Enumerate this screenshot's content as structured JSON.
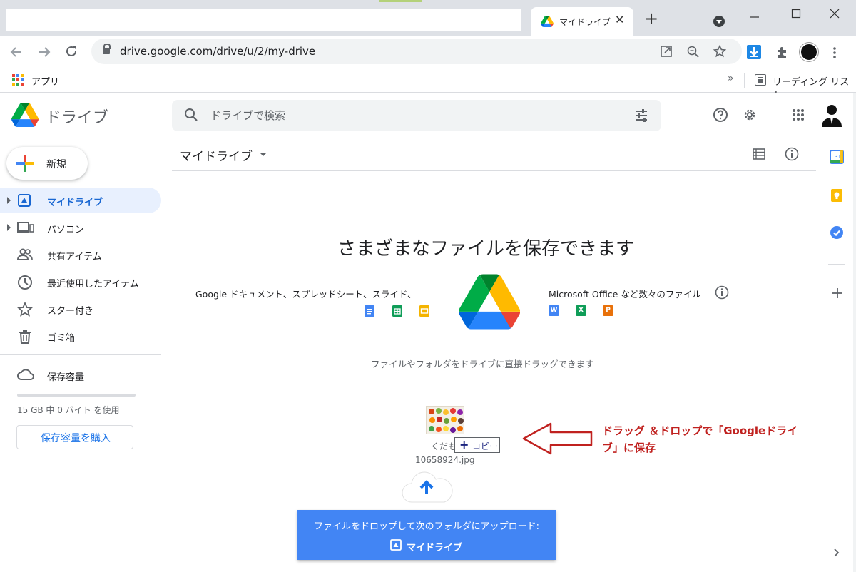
{
  "browser": {
    "tab_title": "マイドライブ",
    "tab_close": "✕",
    "new_tab": "+",
    "url": "drive.google.com/drive/u/2/my-drive",
    "bookmark_apps": "アプリ",
    "bookmark_more": "»",
    "reading_list": "リーディング リスト"
  },
  "drive": {
    "product_name": "ドライブ",
    "search_placeholder": "ドライブで検索",
    "new_button": "新規",
    "nav": [
      {
        "label": "マイドライブ",
        "icon": "my-drive-icon",
        "active": true
      },
      {
        "label": "パソコン",
        "icon": "computers-icon"
      },
      {
        "label": "共有アイテム",
        "icon": "shared-icon"
      },
      {
        "label": "最近使用したアイテム",
        "icon": "clock-icon"
      },
      {
        "label": "スター付き",
        "icon": "star-icon"
      },
      {
        "label": "ゴミ箱",
        "icon": "trash-icon"
      }
    ],
    "storage_label": "保存容量",
    "storage_text": "15 GB 中 0 バイト を使用",
    "storage_used_fraction": 0,
    "buy_storage": "保存容量を購入"
  },
  "main": {
    "title": "マイドライブ",
    "hero": "さまざまなファイルを保存できます",
    "google_docs_text": "Google ドキュメント、スプレッドシート、スライド、",
    "ms_office_text": "Microsoft Office など数々のファイル",
    "word_letter": "W",
    "excel_letter": "X",
    "ppt_letter": "P",
    "drag_hint": "ファイルやフォルダをドライブに直接ドラッグできます",
    "dragged_file_line1": "くだもの",
    "dragged_file_line2": "10658924.jpg",
    "copy_label": "コピー",
    "copy_plus": "+",
    "annotation": "ドラッグ ＆ドロップで「Googleドライブ」に保存",
    "upload_line1": "ファイルをドロップして次のフォルダにアップロード:",
    "upload_folder": "マイドライブ"
  },
  "colors": {
    "accent_blue": "#1a73e8",
    "active_nav_bg": "#e8f0fe",
    "upload_bg": "#4285f4",
    "annotation_red": "#c0211f"
  }
}
